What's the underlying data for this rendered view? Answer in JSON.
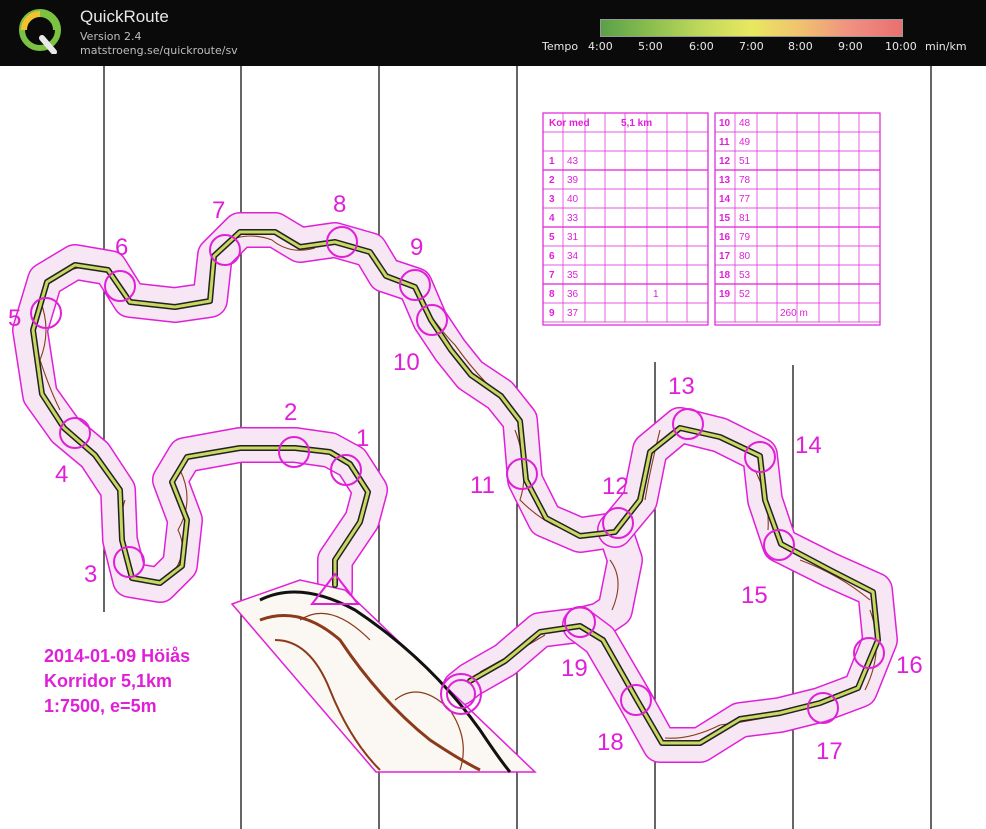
{
  "app": {
    "title": "QuickRoute",
    "version": "Version 2.4",
    "url": "matstroeng.se/quickroute/sv"
  },
  "tempo_legend": {
    "label": "Tempo",
    "ticks": [
      "4:00",
      "5:00",
      "6:00",
      "7:00",
      "8:00",
      "9:00",
      "10:00"
    ],
    "unit": "min/km",
    "colors": [
      "#5aa04a",
      "#8cbf4f",
      "#bfd85a",
      "#e8e860",
      "#f0c070",
      "#f09080",
      "#e87070"
    ]
  },
  "map": {
    "caption_lines": [
      "2014-01-09 Höiås",
      "Korridor 5,1km",
      "1:7500, e=5m"
    ],
    "control_numbers": [
      "1",
      "2",
      "3",
      "4",
      "5",
      "6",
      "7",
      "8",
      "9",
      "10",
      "11",
      "12",
      "13",
      "14",
      "15",
      "16",
      "17",
      "18",
      "19"
    ],
    "colors": {
      "course": "#e020d8",
      "route": "#2a2a2a",
      "contour": "#8b3a1a",
      "corridor_fill": "#f6e0f2"
    }
  },
  "description_sheet": {
    "header": {
      "name": "Kor med",
      "length": "5,1 km"
    },
    "left_rows": [
      {
        "n": "1",
        "code": "43"
      },
      {
        "n": "2",
        "code": "39"
      },
      {
        "n": "3",
        "code": "40"
      },
      {
        "n": "4",
        "code": "33"
      },
      {
        "n": "5",
        "code": "31"
      },
      {
        "n": "6",
        "code": "34"
      },
      {
        "n": "7",
        "code": "35"
      },
      {
        "n": "8",
        "code": "36",
        "extra": "1"
      },
      {
        "n": "9",
        "code": "37"
      }
    ],
    "right_rows": [
      {
        "n": "10",
        "code": "48"
      },
      {
        "n": "11",
        "code": "49"
      },
      {
        "n": "12",
        "code": "51"
      },
      {
        "n": "13",
        "code": "78"
      },
      {
        "n": "14",
        "code": "77"
      },
      {
        "n": "15",
        "code": "81"
      },
      {
        "n": "16",
        "code": "79"
      },
      {
        "n": "17",
        "code": "80"
      },
      {
        "n": "18",
        "code": "53"
      },
      {
        "n": "19",
        "code": "52"
      }
    ],
    "finish_distance": "260 m"
  }
}
